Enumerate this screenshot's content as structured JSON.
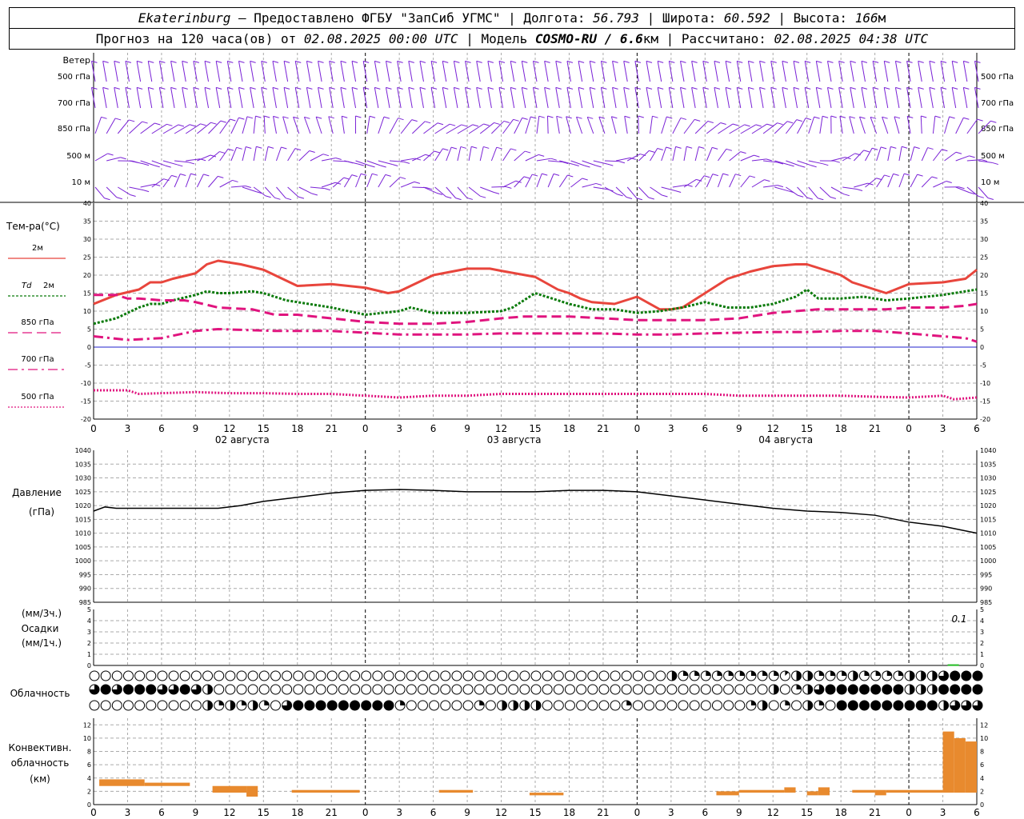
{
  "header": {
    "city": "Ekaterinburg",
    "provider": "– Предоставлено ФГБУ \"ЗапСиб УГМС\" | Долгота:",
    "lon": "56.793",
    "lat_label": "| Широта:",
    "lat": "60.592",
    "alt_label": "| Высота:",
    "alt": "166",
    "alt_unit": "м",
    "forecast_label": "Прогноз на 120 часа(ов) от",
    "forecast_start": "02.08.2025 00:00 UTC",
    "model_label": "| Модель",
    "model": "COSMO-RU / 6.6",
    "model_unit": "км",
    "calc_label": "| Рассчитано:",
    "calc_time": "02.08.2025 04:38 UTC"
  },
  "colors": {
    "t2m": "#e8453c",
    "td2m": "#0a7a0a",
    "t850": "#e0147e",
    "t700": "#e0147e",
    "t500": "#e0147e",
    "wind": "#7a22d6",
    "precip": "#22bb22",
    "conv": "#e88a2e",
    "zero_line": "#2222cc",
    "grid": "#aaaaaa"
  },
  "chart_data": [
    {
      "type": "wind_barbs",
      "title": "Ветер",
      "levels": [
        "500 гПа",
        "700 гПа",
        "850 гПа",
        "500 м",
        "10 м"
      ]
    },
    {
      "type": "line",
      "title": "Тем-ра(°С)",
      "ylim": [
        -20,
        40
      ],
      "yticks": [
        -20,
        -15,
        -10,
        -5,
        0,
        5,
        10,
        15,
        20,
        25,
        30,
        35,
        40
      ],
      "x_hours": [
        0,
        3,
        6,
        9,
        12,
        15,
        18,
        21,
        24,
        27,
        30,
        33,
        36,
        39,
        42,
        45,
        48,
        51,
        54,
        57,
        60,
        63,
        66,
        69,
        72,
        75,
        78
      ],
      "x_tick_labels": [
        "0",
        "3",
        "6",
        "9",
        "12",
        "15",
        "18",
        "21",
        "0",
        "3",
        "6",
        "9",
        "12",
        "15",
        "18",
        "21",
        "0",
        "3",
        "6",
        "9",
        "12",
        "15",
        "18",
        "21",
        "0",
        "3",
        "6"
      ],
      "day_labels": [
        "02 августа",
        "03 августа",
        "04 августа"
      ],
      "series": [
        {
          "name": "2м",
          "key": "t2m",
          "style": "solid",
          "x": [
            0,
            2,
            4,
            5,
            6,
            7,
            9,
            10,
            11,
            13,
            15,
            16,
            18,
            21,
            24,
            26,
            27,
            28,
            30,
            33,
            35,
            36,
            39,
            41,
            42,
            43,
            44,
            46,
            48,
            50,
            51,
            52,
            54,
            55,
            56,
            58,
            60,
            62,
            63,
            64,
            66,
            67,
            68,
            70,
            72,
            75,
            77,
            78
          ],
          "values": [
            12,
            14.5,
            16,
            18,
            18,
            19,
            20.5,
            23,
            24,
            23,
            21.5,
            20,
            17,
            17.5,
            16.5,
            15,
            15.5,
            17,
            20,
            21.8,
            21.8,
            21.2,
            19.5,
            16,
            15,
            13.5,
            12.5,
            12,
            14,
            10.5,
            10.5,
            11,
            15,
            17,
            19,
            21,
            22.5,
            23,
            23,
            22,
            20,
            18,
            17,
            15,
            17.5,
            18,
            19,
            21.5
          ]
        },
        {
          "name": "2м",
          "label_prefix": "Td",
          "key": "td2m",
          "style": "dotted",
          "x": [
            0,
            2,
            4,
            5,
            6,
            7,
            9,
            10,
            11,
            12,
            14,
            15,
            17,
            21,
            24,
            27,
            28,
            30,
            33,
            36,
            37,
            39,
            41,
            42,
            44,
            46,
            48,
            50,
            52,
            54,
            56,
            58,
            60,
            62,
            63,
            64,
            66,
            68,
            70,
            72,
            75,
            77,
            78
          ],
          "values": [
            6.5,
            8,
            11,
            12,
            12,
            13,
            14.5,
            15.5,
            15,
            15,
            15.5,
            15,
            13,
            11,
            9,
            10,
            11,
            9.5,
            9.5,
            10,
            11,
            15,
            13,
            12,
            10.5,
            10.5,
            9.5,
            10,
            11,
            12.5,
            11,
            11,
            12,
            14,
            16,
            13.5,
            13.5,
            14,
            13,
            13.5,
            14.5,
            15.5,
            16
          ]
        },
        {
          "name": "850 гПа",
          "key": "t850",
          "style": "dash",
          "x": [
            0,
            2,
            3,
            4,
            6,
            8,
            9,
            11,
            14,
            16,
            18,
            21,
            24,
            27,
            30,
            33,
            36,
            38,
            40,
            42,
            45,
            48,
            51,
            54,
            57,
            60,
            62,
            64,
            66,
            68,
            70,
            72,
            75,
            77,
            78
          ],
          "values": [
            14.5,
            14.5,
            13.5,
            13.5,
            13,
            13,
            12.5,
            11,
            10.5,
            9,
            9,
            8,
            7,
            6.5,
            6.5,
            7,
            8,
            8.5,
            8.5,
            8.5,
            8,
            7.5,
            7.5,
            7.5,
            8,
            9.5,
            10,
            10.5,
            10.5,
            10.5,
            10.5,
            11,
            11,
            11.5,
            12
          ]
        },
        {
          "name": "700 гПа",
          "key": "t700",
          "style": "dashdot",
          "x": [
            0,
            3,
            6,
            9,
            11,
            13,
            16,
            19,
            21,
            24,
            27,
            30,
            33,
            36,
            39,
            42,
            45,
            48,
            51,
            54,
            57,
            60,
            63,
            66,
            69,
            72,
            75,
            77,
            78
          ],
          "values": [
            3,
            2,
            2.5,
            4.5,
            5,
            4.8,
            4.5,
            4.5,
            4.5,
            4,
            3.5,
            3.5,
            3.5,
            3.8,
            3.8,
            3.8,
            3.8,
            3.5,
            3.5,
            3.8,
            4,
            4.2,
            4.2,
            4.5,
            4.5,
            3.8,
            3,
            2.5,
            1.5
          ]
        },
        {
          "name": "500 гПа",
          "key": "t500",
          "style": "fine",
          "x": [
            0,
            3,
            4,
            6,
            9,
            12,
            15,
            18,
            21,
            24,
            27,
            30,
            33,
            36,
            39,
            42,
            45,
            48,
            51,
            54,
            57,
            60,
            63,
            66,
            69,
            72,
            75,
            76,
            78
          ],
          "values": [
            -12,
            -12,
            -13,
            -12.8,
            -12.5,
            -12.8,
            -12.8,
            -13,
            -13,
            -13.5,
            -14,
            -13.5,
            -13.5,
            -13,
            -13,
            -13,
            -13,
            -13,
            -13,
            -13,
            -13.5,
            -13.5,
            -13.5,
            -13.5,
            -13.8,
            -14,
            -13.5,
            -14.5,
            -14
          ]
        }
      ]
    },
    {
      "type": "line",
      "title": "Давление",
      "unit": "(гПа)",
      "ylim": [
        985,
        1040
      ],
      "yticks": [
        985,
        990,
        995,
        1000,
        1005,
        1010,
        1015,
        1020,
        1025,
        1030,
        1035,
        1040
      ],
      "series": [
        {
          "name": "Давление",
          "x": [
            0,
            1,
            2,
            6,
            9,
            11,
            13,
            15,
            18,
            21,
            24,
            27,
            30,
            33,
            36,
            39,
            42,
            45,
            48,
            51,
            54,
            57,
            60,
            63,
            66,
            69,
            72,
            75,
            78
          ],
          "values": [
            1018,
            1019.5,
            1019,
            1019,
            1019,
            1019,
            1020,
            1021.5,
            1023,
            1024.5,
            1025.5,
            1025.8,
            1025.5,
            1025,
            1025,
            1025,
            1025.5,
            1025.5,
            1025,
            1023.5,
            1022,
            1020.5,
            1019,
            1018,
            1017.5,
            1016.5,
            1014,
            1012.5,
            1010
          ]
        }
      ]
    },
    {
      "type": "bar",
      "title": "Осадки",
      "units": [
        "(мм/3ч.)",
        "(мм/1ч.)"
      ],
      "ylim": [
        0,
        5
      ],
      "yticks": [
        0,
        1,
        2,
        3,
        4,
        5
      ],
      "annotation": "0.1",
      "values": [
        {
          "x": 75,
          "value": 0.1
        }
      ]
    },
    {
      "type": "cloud_cover",
      "title": "Облачность",
      "rows": [
        [
          "0:0",
          "51:8",
          "52:4",
          "61:2",
          "62:8",
          "64:4",
          "67:8",
          "68:4",
          "72:8",
          "75:12",
          "76:16"
        ],
        [
          "0:12",
          "1:16",
          "2:12",
          "3:16",
          "6:12",
          "8:16",
          "9:12",
          "10:8",
          "11:0",
          "60:8",
          "61:0",
          "62:4",
          "63:8",
          "64:12",
          "65:16",
          "72:8",
          "75:16"
        ],
        [
          "0:0",
          "10:8",
          "11:4",
          "12:8",
          "13:4",
          "14:8",
          "15:4",
          "16:0",
          "17:12",
          "18:16",
          "27:4",
          "28:0",
          "34:4",
          "35:0",
          "36:8",
          "40:0",
          "47:4",
          "48:0",
          "58:4",
          "59:8",
          "60:0",
          "61:4",
          "62:0",
          "63:8",
          "64:4",
          "65:0",
          "66:16",
          "75:8",
          "76:12"
        ]
      ]
    },
    {
      "type": "bar",
      "title": "Конвективн. облачность",
      "unit": "(км)",
      "ylim": [
        0,
        13
      ],
      "yticks": [
        0,
        2,
        4,
        6,
        8,
        10,
        12
      ],
      "bars": [
        {
          "x0": 0.5,
          "x1": 4.5,
          "bottom": 2.8,
          "top": 3.8
        },
        {
          "x0": 4.5,
          "x1": 8.5,
          "bottom": 2.8,
          "top": 3.3
        },
        {
          "x0": 10.5,
          "x1": 13.5,
          "bottom": 1.8,
          "top": 2.8
        },
        {
          "x0": 13.5,
          "x1": 14.5,
          "bottom": 1.2,
          "top": 2.8
        },
        {
          "x0": 17.5,
          "x1": 23.5,
          "bottom": 1.8,
          "top": 2.2
        },
        {
          "x0": 30.5,
          "x1": 33.5,
          "bottom": 1.8,
          "top": 2.2
        },
        {
          "x0": 38.5,
          "x1": 41.5,
          "bottom": 1.4,
          "top": 1.8
        },
        {
          "x0": 55,
          "x1": 57,
          "bottom": 1.4,
          "top": 2.0
        },
        {
          "x0": 57,
          "x1": 61,
          "bottom": 1.8,
          "top": 2.2
        },
        {
          "x0": 61,
          "x1": 62,
          "bottom": 1.8,
          "top": 2.6
        },
        {
          "x0": 63,
          "x1": 64,
          "bottom": 1.4,
          "top": 2.0
        },
        {
          "x0": 64,
          "x1": 65,
          "bottom": 1.4,
          "top": 2.6
        },
        {
          "x0": 67,
          "x1": 69,
          "bottom": 1.8,
          "top": 2.2
        },
        {
          "x0": 69,
          "x1": 70,
          "bottom": 1.4,
          "top": 2.2
        },
        {
          "x0": 70,
          "x1": 75,
          "bottom": 1.8,
          "top": 2.2
        },
        {
          "x0": 75,
          "x1": 76,
          "bottom": 1.8,
          "top": 11
        },
        {
          "x0": 76,
          "x1": 77,
          "bottom": 1.8,
          "top": 10
        },
        {
          "x0": 77,
          "x1": 78,
          "bottom": 1.8,
          "top": 9.5
        }
      ]
    }
  ]
}
